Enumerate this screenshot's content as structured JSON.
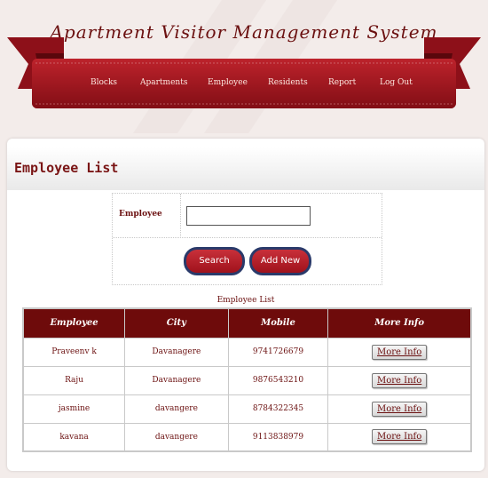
{
  "header": {
    "title": "Apartment Visitor Management System",
    "nav": [
      "Blocks",
      "Apartments",
      "Employee",
      "Residents",
      "Report",
      "Log Out"
    ]
  },
  "page": {
    "title": "Employee List"
  },
  "form": {
    "employee_label": "Employee",
    "employee_value": "",
    "search_label": "Search",
    "add_label": "Add New"
  },
  "table": {
    "caption": "Employee List",
    "columns": [
      "Employee",
      "City",
      "Mobile",
      "More Info"
    ],
    "rows": [
      {
        "employee": "Praveenv k",
        "city": "Davanagere",
        "mobile": "9741726679",
        "action": "More Info"
      },
      {
        "employee": "Raju",
        "city": "Davanagere",
        "mobile": "9876543210",
        "action": "More Info"
      },
      {
        "employee": "jasmine",
        "city": "davangere",
        "mobile": "8784322345",
        "action": "More Info"
      },
      {
        "employee": "kavana",
        "city": "davangere",
        "mobile": "9113838979",
        "action": "More Info"
      }
    ]
  },
  "colors": {
    "accent": "#a3161f",
    "header_dark": "#6e0b0b",
    "background": "#f3ecea"
  }
}
